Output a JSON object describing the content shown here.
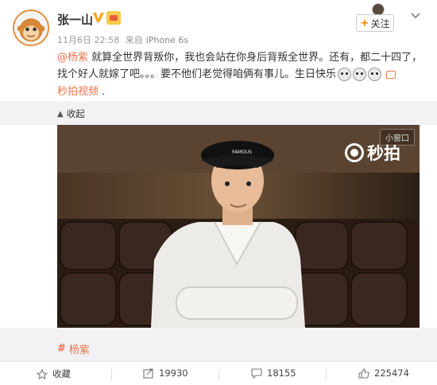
{
  "post": {
    "username": "张一山",
    "date": "11月6日 22:58",
    "source_prefix": "来自",
    "device": "iPhone 6s",
    "mention": "@杨紫",
    "text_line1": " 就算全世界背叛你，我也会站在你身后背叛全世界。还有，都二十四了，",
    "text_line2": "找个好人就嫁了吧。。。要不他们老觉得咱俩有事儿。生日快乐",
    "video_link": "秒拍视频",
    "video_link_suffix": "."
  },
  "follow": {
    "label": "关注",
    "plus": "+"
  },
  "retract": {
    "label": "收起",
    "arrow": "▲"
  },
  "video": {
    "mini_window_label": "小窗口",
    "logo_text": "秒拍",
    "cap_text": "FAMOUS"
  },
  "topic": {
    "hash": "#",
    "label": "杨紫"
  },
  "actions": {
    "favorite": "收藏",
    "share_count": "19930",
    "comment_count": "18155",
    "like_count": "225474"
  },
  "colors": {
    "accent": "#eb7350",
    "follow_plus": "#ff8200",
    "bar_bg": "#f2f2f5"
  },
  "icons": [
    "avatar-monkey",
    "verified-v-icon",
    "member-badge-icon",
    "chevron-down-icon",
    "emoji-icon",
    "video-link-icon",
    "collapse-arrow-icon",
    "miaopai-camera-icon",
    "star-icon",
    "share-icon",
    "comment-icon",
    "like-icon"
  ]
}
